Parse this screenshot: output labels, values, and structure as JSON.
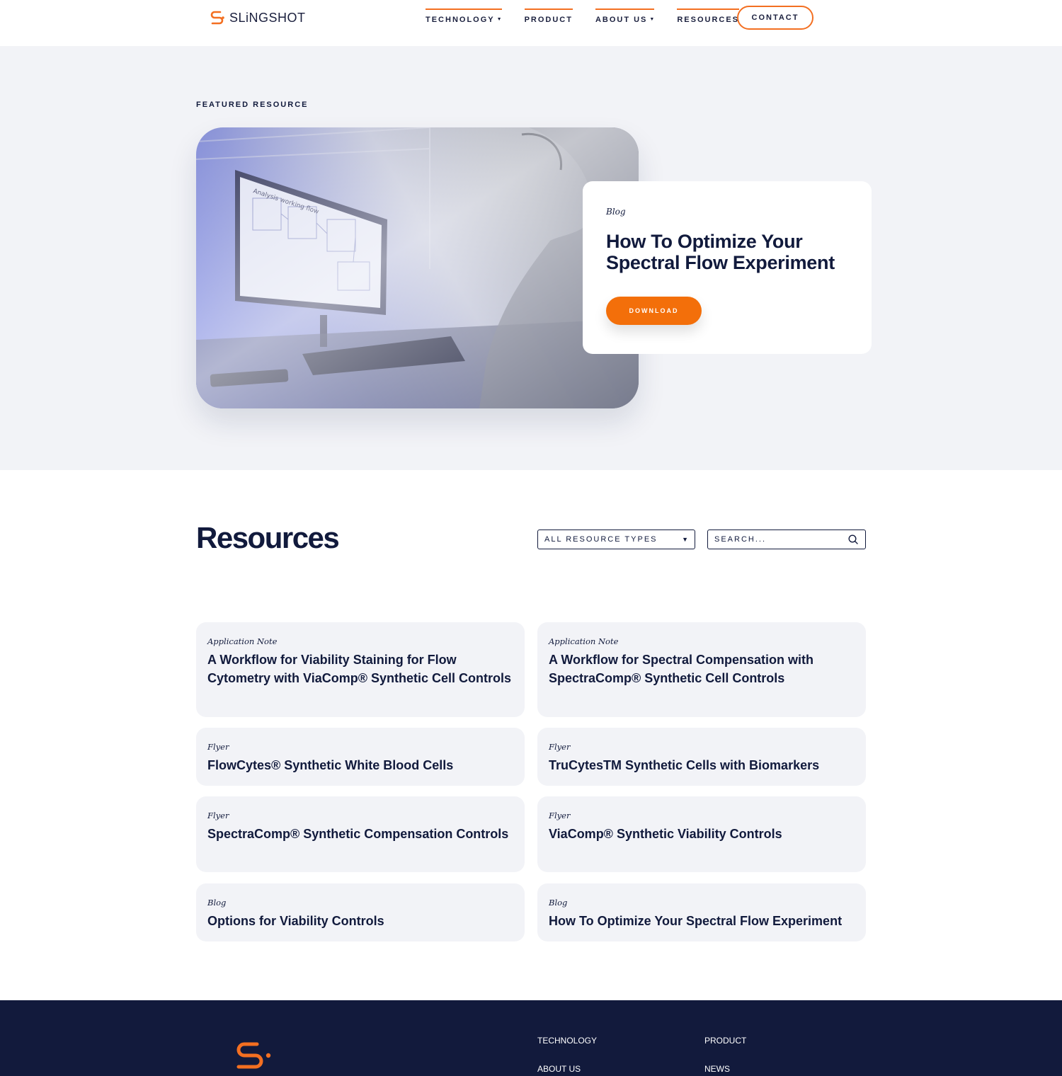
{
  "brand": {
    "name": "SLiNGSHOT",
    "accent_color": "#f36f21",
    "navy_color": "#111a3c"
  },
  "nav": {
    "items": [
      {
        "label": "TECHNOLOGY",
        "has_dropdown": true
      },
      {
        "label": "PRODUCT",
        "has_dropdown": false
      },
      {
        "label": "ABOUT US",
        "has_dropdown": true
      },
      {
        "label": "RESOURCES",
        "has_dropdown": false
      }
    ],
    "contact_label": "CONTACT"
  },
  "featured": {
    "section_label": "FEATURED RESOURCE",
    "tag": "Blog",
    "title": "How To Optimize Your Spectral Flow Experiment",
    "button_label": "DOWNLOAD"
  },
  "resources": {
    "title": "Resources",
    "filter_value": "ALL RESOURCE TYPES",
    "search_placeholder": "SEARCH...",
    "cards": [
      {
        "tag": "Application Note",
        "title": "A Workflow for Viability Staining for Flow Cytometry with ViaComp® Synthetic Cell Controls"
      },
      {
        "tag": "Application Note",
        "title": "A Workflow for Spectral Compensation with SpectraComp® Synthetic Cell Controls"
      },
      {
        "tag": "Flyer",
        "title": "FlowCytes® Synthetic White Blood Cells"
      },
      {
        "tag": "Flyer",
        "title": "TruCytesTM Synthetic Cells with Biomarkers"
      },
      {
        "tag": "Flyer",
        "title": "SpectraComp® Synthetic Compensation Controls"
      },
      {
        "tag": "Flyer",
        "title": "ViaComp® Synthetic Viability Controls"
      },
      {
        "tag": "Blog",
        "title": "Options for Viability Controls"
      },
      {
        "tag": "Blog",
        "title": "How To Optimize Your Spectral Flow Experiment"
      }
    ]
  },
  "footer": {
    "links": [
      "TECHNOLOGY",
      "PRODUCT",
      "ABOUT US",
      "NEWS"
    ]
  }
}
